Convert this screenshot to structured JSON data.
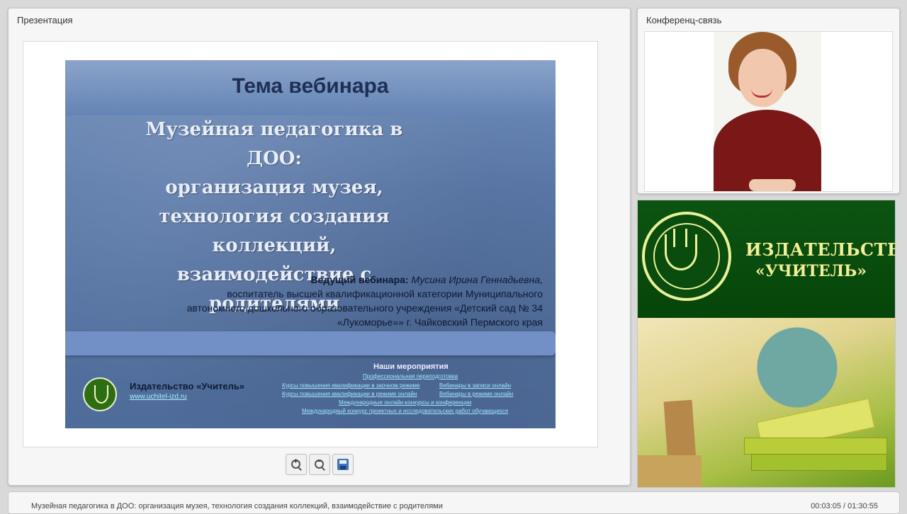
{
  "presentation_panel": {
    "title": "Презентация"
  },
  "slide": {
    "heading": "Тема вебинара",
    "title_lines": [
      "Музейная педагогика в ДОО:",
      "организация музея,",
      "технология создания",
      "коллекций, взаимодействие с",
      "родителями"
    ],
    "host_label": "Ведущий вебинара:",
    "host_name": "Мусина Ирина Геннадьевна,",
    "host_lines": [
      "воспитатель высшей квалификационной категории Муниципального",
      "автономного дошкольного образовательного учреждения «Детский сад № 34",
      "«Лукоморье»» г. Чайковский Пермского края"
    ],
    "publisher": "Издательство «Учитель»",
    "publisher_site": "www.uchitel-izd.ru",
    "events_title": "Наши мероприятия",
    "events": [
      "Профессиональная переподготовка",
      "Курсы повышения квалификации в заочном режиме",
      "Вебинары в записи онлайн",
      "Курсы повышения квалификации в режиме онлайн",
      "Вебинары в режиме онлайн",
      "Международные онлайн-конкурсы и конференции",
      "Международный конкурс проектных и исследовательских работ обучающихся"
    ]
  },
  "toolbar": {
    "zoom_in_icon": "zoom-in-icon",
    "zoom_out_icon": "zoom-out-icon",
    "save_icon": "save-icon",
    "zoom_in_symbol": "+",
    "zoom_out_symbol": "−"
  },
  "conference_panel": {
    "title": "Конференц-связь"
  },
  "advert": {
    "publisher_line1": "ИЗДАТЕЛЬСТВО",
    "publisher_line2": "«УЧИТЕЛЬ»",
    "brand_color": "#0a4c0d",
    "text_color": "#f2ef96"
  },
  "status": {
    "webinar_title": "Музейная педагогика в ДОО: организация музея, технология создания коллекций, взаимодействие с родителями",
    "time": "00:03:05 / 01:30:55"
  }
}
